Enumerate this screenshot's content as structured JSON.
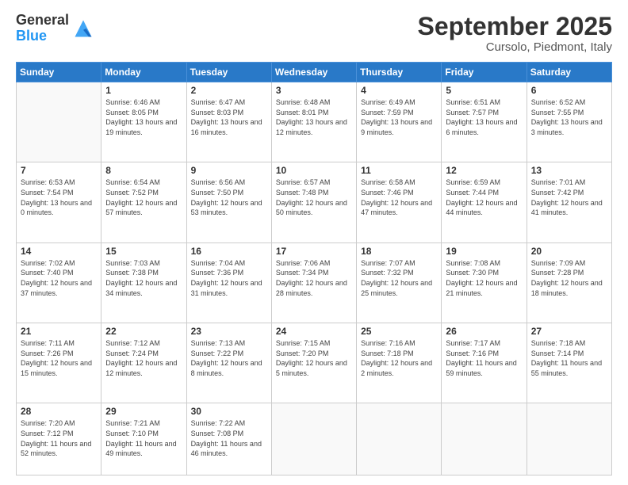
{
  "header": {
    "logo": {
      "line1": "General",
      "line2": "Blue"
    },
    "title": "September 2025",
    "subtitle": "Cursolo, Piedmont, Italy"
  },
  "weekdays": [
    "Sunday",
    "Monday",
    "Tuesday",
    "Wednesday",
    "Thursday",
    "Friday",
    "Saturday"
  ],
  "weeks": [
    [
      {
        "day": "",
        "sunrise": "",
        "sunset": "",
        "daylight": ""
      },
      {
        "day": "1",
        "sunrise": "Sunrise: 6:46 AM",
        "sunset": "Sunset: 8:05 PM",
        "daylight": "Daylight: 13 hours and 19 minutes."
      },
      {
        "day": "2",
        "sunrise": "Sunrise: 6:47 AM",
        "sunset": "Sunset: 8:03 PM",
        "daylight": "Daylight: 13 hours and 16 minutes."
      },
      {
        "day": "3",
        "sunrise": "Sunrise: 6:48 AM",
        "sunset": "Sunset: 8:01 PM",
        "daylight": "Daylight: 13 hours and 12 minutes."
      },
      {
        "day": "4",
        "sunrise": "Sunrise: 6:49 AM",
        "sunset": "Sunset: 7:59 PM",
        "daylight": "Daylight: 13 hours and 9 minutes."
      },
      {
        "day": "5",
        "sunrise": "Sunrise: 6:51 AM",
        "sunset": "Sunset: 7:57 PM",
        "daylight": "Daylight: 13 hours and 6 minutes."
      },
      {
        "day": "6",
        "sunrise": "Sunrise: 6:52 AM",
        "sunset": "Sunset: 7:55 PM",
        "daylight": "Daylight: 13 hours and 3 minutes."
      }
    ],
    [
      {
        "day": "7",
        "sunrise": "Sunrise: 6:53 AM",
        "sunset": "Sunset: 7:54 PM",
        "daylight": "Daylight: 13 hours and 0 minutes."
      },
      {
        "day": "8",
        "sunrise": "Sunrise: 6:54 AM",
        "sunset": "Sunset: 7:52 PM",
        "daylight": "Daylight: 12 hours and 57 minutes."
      },
      {
        "day": "9",
        "sunrise": "Sunrise: 6:56 AM",
        "sunset": "Sunset: 7:50 PM",
        "daylight": "Daylight: 12 hours and 53 minutes."
      },
      {
        "day": "10",
        "sunrise": "Sunrise: 6:57 AM",
        "sunset": "Sunset: 7:48 PM",
        "daylight": "Daylight: 12 hours and 50 minutes."
      },
      {
        "day": "11",
        "sunrise": "Sunrise: 6:58 AM",
        "sunset": "Sunset: 7:46 PM",
        "daylight": "Daylight: 12 hours and 47 minutes."
      },
      {
        "day": "12",
        "sunrise": "Sunrise: 6:59 AM",
        "sunset": "Sunset: 7:44 PM",
        "daylight": "Daylight: 12 hours and 44 minutes."
      },
      {
        "day": "13",
        "sunrise": "Sunrise: 7:01 AM",
        "sunset": "Sunset: 7:42 PM",
        "daylight": "Daylight: 12 hours and 41 minutes."
      }
    ],
    [
      {
        "day": "14",
        "sunrise": "Sunrise: 7:02 AM",
        "sunset": "Sunset: 7:40 PM",
        "daylight": "Daylight: 12 hours and 37 minutes."
      },
      {
        "day": "15",
        "sunrise": "Sunrise: 7:03 AM",
        "sunset": "Sunset: 7:38 PM",
        "daylight": "Daylight: 12 hours and 34 minutes."
      },
      {
        "day": "16",
        "sunrise": "Sunrise: 7:04 AM",
        "sunset": "Sunset: 7:36 PM",
        "daylight": "Daylight: 12 hours and 31 minutes."
      },
      {
        "day": "17",
        "sunrise": "Sunrise: 7:06 AM",
        "sunset": "Sunset: 7:34 PM",
        "daylight": "Daylight: 12 hours and 28 minutes."
      },
      {
        "day": "18",
        "sunrise": "Sunrise: 7:07 AM",
        "sunset": "Sunset: 7:32 PM",
        "daylight": "Daylight: 12 hours and 25 minutes."
      },
      {
        "day": "19",
        "sunrise": "Sunrise: 7:08 AM",
        "sunset": "Sunset: 7:30 PM",
        "daylight": "Daylight: 12 hours and 21 minutes."
      },
      {
        "day": "20",
        "sunrise": "Sunrise: 7:09 AM",
        "sunset": "Sunset: 7:28 PM",
        "daylight": "Daylight: 12 hours and 18 minutes."
      }
    ],
    [
      {
        "day": "21",
        "sunrise": "Sunrise: 7:11 AM",
        "sunset": "Sunset: 7:26 PM",
        "daylight": "Daylight: 12 hours and 15 minutes."
      },
      {
        "day": "22",
        "sunrise": "Sunrise: 7:12 AM",
        "sunset": "Sunset: 7:24 PM",
        "daylight": "Daylight: 12 hours and 12 minutes."
      },
      {
        "day": "23",
        "sunrise": "Sunrise: 7:13 AM",
        "sunset": "Sunset: 7:22 PM",
        "daylight": "Daylight: 12 hours and 8 minutes."
      },
      {
        "day": "24",
        "sunrise": "Sunrise: 7:15 AM",
        "sunset": "Sunset: 7:20 PM",
        "daylight": "Daylight: 12 hours and 5 minutes."
      },
      {
        "day": "25",
        "sunrise": "Sunrise: 7:16 AM",
        "sunset": "Sunset: 7:18 PM",
        "daylight": "Daylight: 12 hours and 2 minutes."
      },
      {
        "day": "26",
        "sunrise": "Sunrise: 7:17 AM",
        "sunset": "Sunset: 7:16 PM",
        "daylight": "Daylight: 11 hours and 59 minutes."
      },
      {
        "day": "27",
        "sunrise": "Sunrise: 7:18 AM",
        "sunset": "Sunset: 7:14 PM",
        "daylight": "Daylight: 11 hours and 55 minutes."
      }
    ],
    [
      {
        "day": "28",
        "sunrise": "Sunrise: 7:20 AM",
        "sunset": "Sunset: 7:12 PM",
        "daylight": "Daylight: 11 hours and 52 minutes."
      },
      {
        "day": "29",
        "sunrise": "Sunrise: 7:21 AM",
        "sunset": "Sunset: 7:10 PM",
        "daylight": "Daylight: 11 hours and 49 minutes."
      },
      {
        "day": "30",
        "sunrise": "Sunrise: 7:22 AM",
        "sunset": "Sunset: 7:08 PM",
        "daylight": "Daylight: 11 hours and 46 minutes."
      },
      {
        "day": "",
        "sunrise": "",
        "sunset": "",
        "daylight": ""
      },
      {
        "day": "",
        "sunrise": "",
        "sunset": "",
        "daylight": ""
      },
      {
        "day": "",
        "sunrise": "",
        "sunset": "",
        "daylight": ""
      },
      {
        "day": "",
        "sunrise": "",
        "sunset": "",
        "daylight": ""
      }
    ]
  ]
}
